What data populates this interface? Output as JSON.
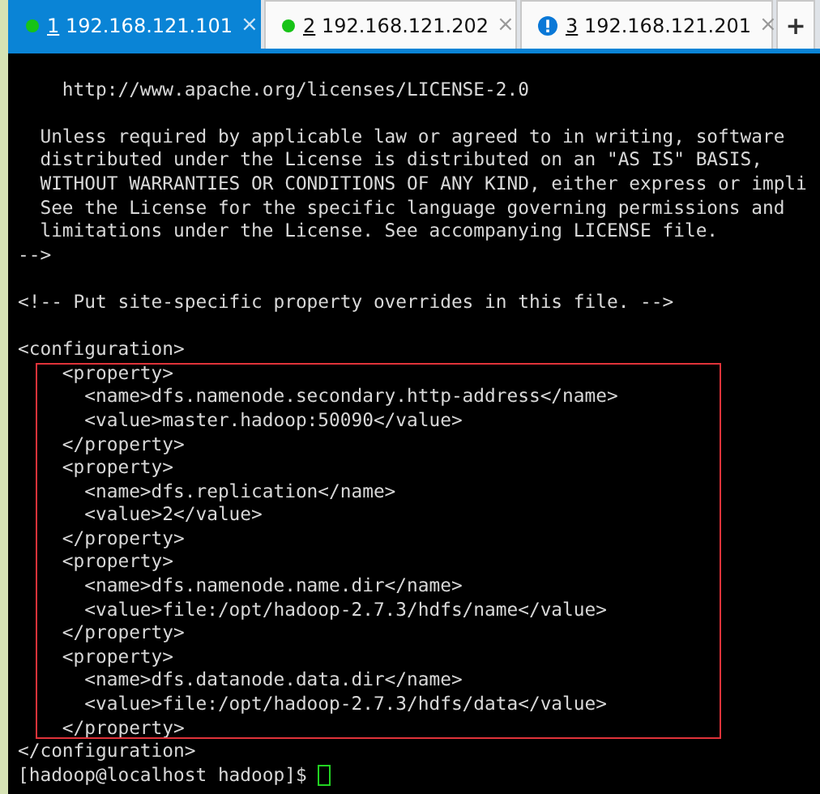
{
  "tabs": [
    {
      "number": "1",
      "label": "192.168.121.101",
      "kind": "connected",
      "selected": true,
      "close": "×"
    },
    {
      "number": "2",
      "label": "192.168.121.202",
      "kind": "connected",
      "selected": false,
      "close": "×"
    },
    {
      "number": "3",
      "label": "192.168.121.201",
      "kind": "alert",
      "selected": false,
      "close": "×"
    }
  ],
  "new_tab_button": "+",
  "terminal": {
    "lines": [
      {
        "kind": "blank"
      },
      {
        "kind": "text",
        "text": "    http://www.apache.org/licenses/LICENSE-2.0"
      },
      {
        "kind": "blank"
      },
      {
        "kind": "text",
        "text": "  Unless required by applicable law or agreed to in writing, software"
      },
      {
        "kind": "text",
        "text": "  distributed under the License is distributed on an \"AS IS\" BASIS,"
      },
      {
        "kind": "text",
        "text": "  WITHOUT WARRANTIES OR CONDITIONS OF ANY KIND, either express or impli"
      },
      {
        "kind": "text",
        "text": "  See the License for the specific language governing permissions and"
      },
      {
        "kind": "text",
        "text": "  limitations under the License. See accompanying LICENSE file."
      },
      {
        "kind": "text",
        "text": "-->"
      },
      {
        "kind": "blank"
      },
      {
        "kind": "text",
        "text": "<!-- Put site-specific property overrides in this file. -->"
      },
      {
        "kind": "blank"
      },
      {
        "kind": "text",
        "text": "<configuration>"
      },
      {
        "kind": "text",
        "text": "    <property>"
      },
      {
        "kind": "text",
        "text": "      <name>dfs.namenode.secondary.http-address</name>"
      },
      {
        "kind": "text",
        "text": "      <value>master.hadoop:50090</value>"
      },
      {
        "kind": "text",
        "text": "    </property>"
      },
      {
        "kind": "text",
        "text": "    <property>"
      },
      {
        "kind": "text",
        "text": "      <name>dfs.replication</name>"
      },
      {
        "kind": "text",
        "text": "      <value>2</value>"
      },
      {
        "kind": "text",
        "text": "    </property>"
      },
      {
        "kind": "text",
        "text": "    <property>"
      },
      {
        "kind": "text",
        "text": "      <name>dfs.namenode.name.dir</name>"
      },
      {
        "kind": "text",
        "text": "      <value>file:/opt/hadoop-2.7.3/hdfs/name</value>"
      },
      {
        "kind": "text",
        "text": "    </property>"
      },
      {
        "kind": "text",
        "text": "    <property>"
      },
      {
        "kind": "text",
        "text": "      <name>dfs.datanode.data.dir</name>"
      },
      {
        "kind": "text",
        "text": "      <value>file:/opt/hadoop-2.7.3/hdfs/data</value>"
      },
      {
        "kind": "text",
        "text": "    </property>"
      },
      {
        "kind": "text",
        "text": "</configuration>"
      },
      {
        "kind": "prompt",
        "text": "[hadoop@localhost hadoop]$"
      }
    ]
  }
}
